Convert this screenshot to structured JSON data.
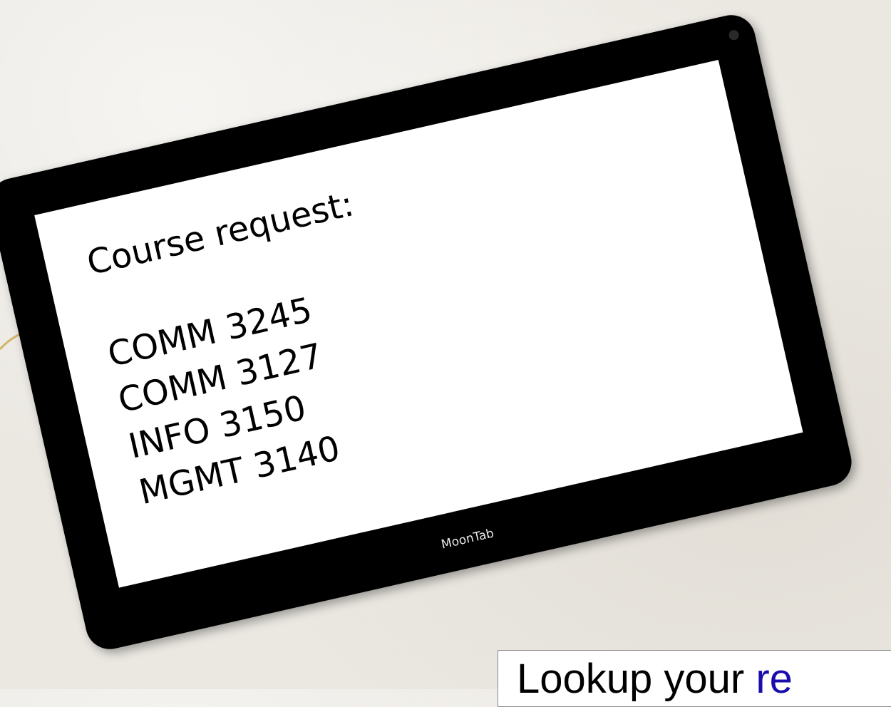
{
  "tablet": {
    "brand": "MoonTab",
    "screen": {
      "title": "Course request:",
      "courses": [
        "COMM 3245",
        "COMM 3127",
        "INFO 3150",
        "MGMT 3140"
      ]
    }
  },
  "callout": {
    "text": "Lookup your ",
    "link_text": "re"
  },
  "colors": {
    "background": "#ebe8e2",
    "tablet_bezel": "#000000",
    "screen": "#ffffff",
    "accent_gold": "#d4b46a",
    "link": "#1a0dab"
  }
}
